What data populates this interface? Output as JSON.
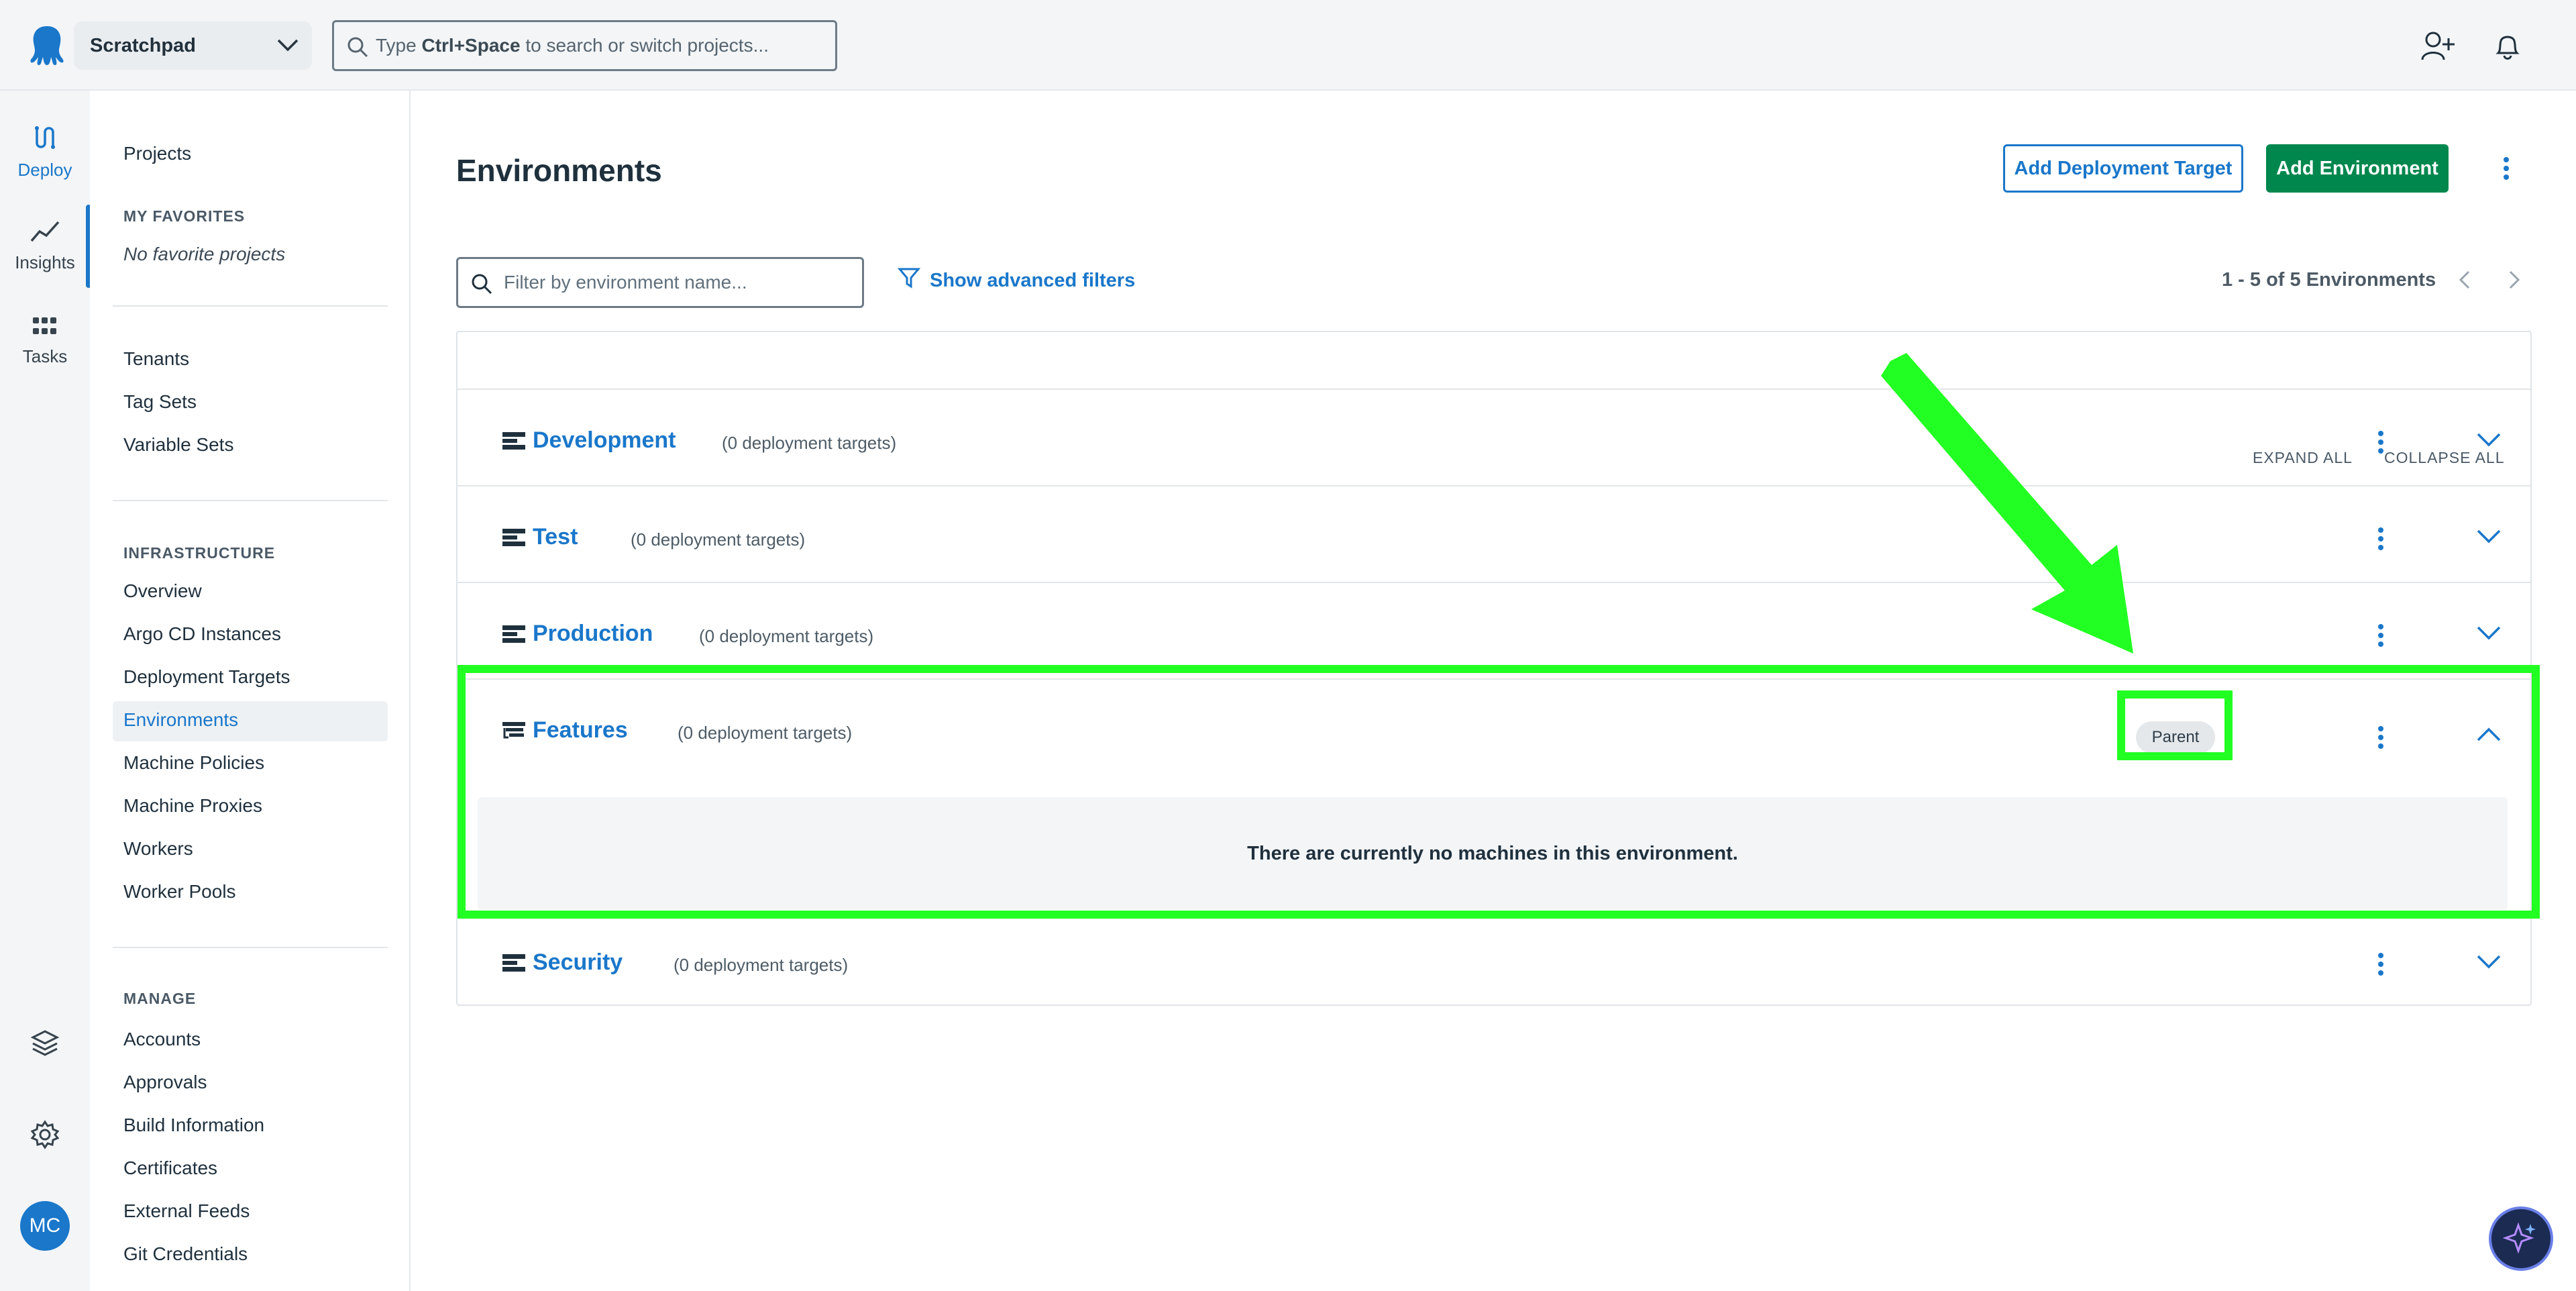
{
  "header": {
    "space_name": "Scratchpad",
    "search_prefix": "Type ",
    "search_shortcut": "Ctrl+Space",
    "search_suffix": " to search or switch projects..."
  },
  "rail": {
    "deploy": "Deploy",
    "insights": "Insights",
    "tasks": "Tasks",
    "avatar": "MC"
  },
  "nav": {
    "projects": "Projects",
    "favorites_heading": "MY FAVORITES",
    "favorites_empty": "No favorite projects",
    "library": [
      "Tenants",
      "Tag Sets",
      "Variable Sets"
    ],
    "infra_heading": "INFRASTRUCTURE",
    "infra": [
      "Overview",
      "Argo CD Instances",
      "Deployment Targets",
      "Environments",
      "Machine Policies",
      "Machine Proxies",
      "Workers",
      "Worker Pools"
    ],
    "manage_heading": "MANAGE",
    "manage": [
      "Accounts",
      "Approvals",
      "Build Information",
      "Certificates",
      "External Feeds",
      "Git Credentials"
    ]
  },
  "main": {
    "title": "Environments",
    "add_target": "Add Deployment Target",
    "add_environment": "Add Environment",
    "filter_placeholder": "Filter by environment name...",
    "advanced_filters": "Show advanced filters",
    "pager": "1 - 5 of 5 Environments",
    "expand_all": "EXPAND ALL",
    "collapse_all": "COLLAPSE ALL",
    "environments": [
      {
        "name": "Development",
        "count": "(0 deployment targets)"
      },
      {
        "name": "Test",
        "count": "(0 deployment targets)"
      },
      {
        "name": "Production",
        "count": "(0 deployment targets)"
      },
      {
        "name": "Features",
        "count": "(0 deployment targets)",
        "badge": "Parent",
        "empty": "There are currently no machines in this environment."
      },
      {
        "name": "Security",
        "count": "(0 deployment targets)"
      }
    ]
  },
  "colors": {
    "accent": "#1a77ca",
    "primary_button": "#00874d",
    "highlight": "#22ff22"
  }
}
